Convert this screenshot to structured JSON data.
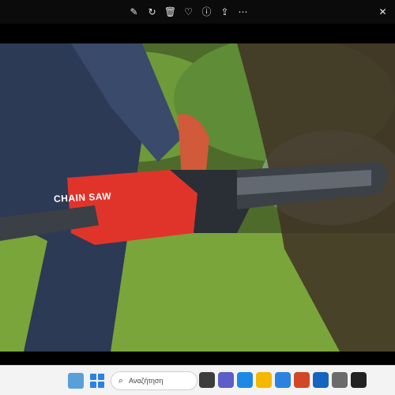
{
  "viewer": {
    "toolbar_icons": [
      {
        "name": "edit-icon",
        "glyph": "✎"
      },
      {
        "name": "rotate-icon",
        "glyph": "↻"
      },
      {
        "name": "delete-icon",
        "glyph": "🗑"
      },
      {
        "name": "favorite-icon",
        "glyph": "♡"
      },
      {
        "name": "info-icon",
        "glyph": "ⓘ"
      },
      {
        "name": "share-icon",
        "glyph": "⇪"
      },
      {
        "name": "more-icon",
        "glyph": "⋯"
      }
    ],
    "close_glyph": "✕"
  },
  "photo": {
    "chainsaw_brand_text": "CHAIN SAW"
  },
  "taskbar": {
    "search_placeholder": "Αναζήτηση",
    "apps": [
      {
        "name": "task-view-icon",
        "color": "#3d3d3d"
      },
      {
        "name": "teams-icon",
        "color": "#5b5fc7"
      },
      {
        "name": "edge-icon",
        "color": "#1e88e5"
      },
      {
        "name": "explorer-icon",
        "color": "#f5b700"
      },
      {
        "name": "store-icon",
        "color": "#2b82e0"
      },
      {
        "name": "office-icon",
        "color": "#d24726"
      },
      {
        "name": "photos-icon",
        "color": "#1565c0"
      },
      {
        "name": "settings-icon",
        "color": "#6b6b6b"
      },
      {
        "name": "camera-icon",
        "color": "#222222"
      }
    ]
  },
  "colors": {
    "saw_body": "#e0342a",
    "bar_steel": "#3c4148",
    "grass": "#7aa53a"
  }
}
